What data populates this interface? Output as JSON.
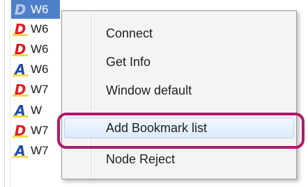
{
  "node_list": {
    "rows": [
      {
        "icon": "D",
        "icon_name": "node-d-icon",
        "label": "W6",
        "selected": true
      },
      {
        "icon": "D",
        "icon_name": "node-d-icon",
        "label": "W6",
        "selected": false
      },
      {
        "icon": "D",
        "icon_name": "node-d-icon",
        "label": "W6",
        "selected": false
      },
      {
        "icon": "A",
        "icon_name": "node-a-icon",
        "label": "W6",
        "selected": false
      },
      {
        "icon": "D",
        "icon_name": "node-d-icon",
        "label": "W7",
        "selected": false
      },
      {
        "icon": "A",
        "icon_name": "node-a-icon",
        "label": "W",
        "selected": false
      },
      {
        "icon": "D",
        "icon_name": "node-d-icon",
        "label": "W7",
        "selected": false
      },
      {
        "icon": "A",
        "icon_name": "node-a-icon",
        "label": "W7",
        "selected": false
      }
    ]
  },
  "context_menu": {
    "items": [
      {
        "name": "menu-item-connect",
        "label": "Connect",
        "hovered": false
      },
      {
        "name": "menu-item-get-info",
        "label": "Get Info",
        "hovered": false
      },
      {
        "name": "menu-item-window-default",
        "label": "Window default",
        "hovered": false
      },
      {
        "name": "menu-item-add-bookmark-list",
        "label": "Add Bookmark list",
        "hovered": true
      },
      {
        "name": "menu-item-node-reject",
        "label": "Node Reject",
        "hovered": false
      }
    ]
  },
  "colors": {
    "d_icon": "#e31b23",
    "a_icon": "#1f4ca8",
    "selection": "#4f7fc9",
    "highlight_ring": "#b1186a",
    "hover_background": "#dcebfb"
  }
}
